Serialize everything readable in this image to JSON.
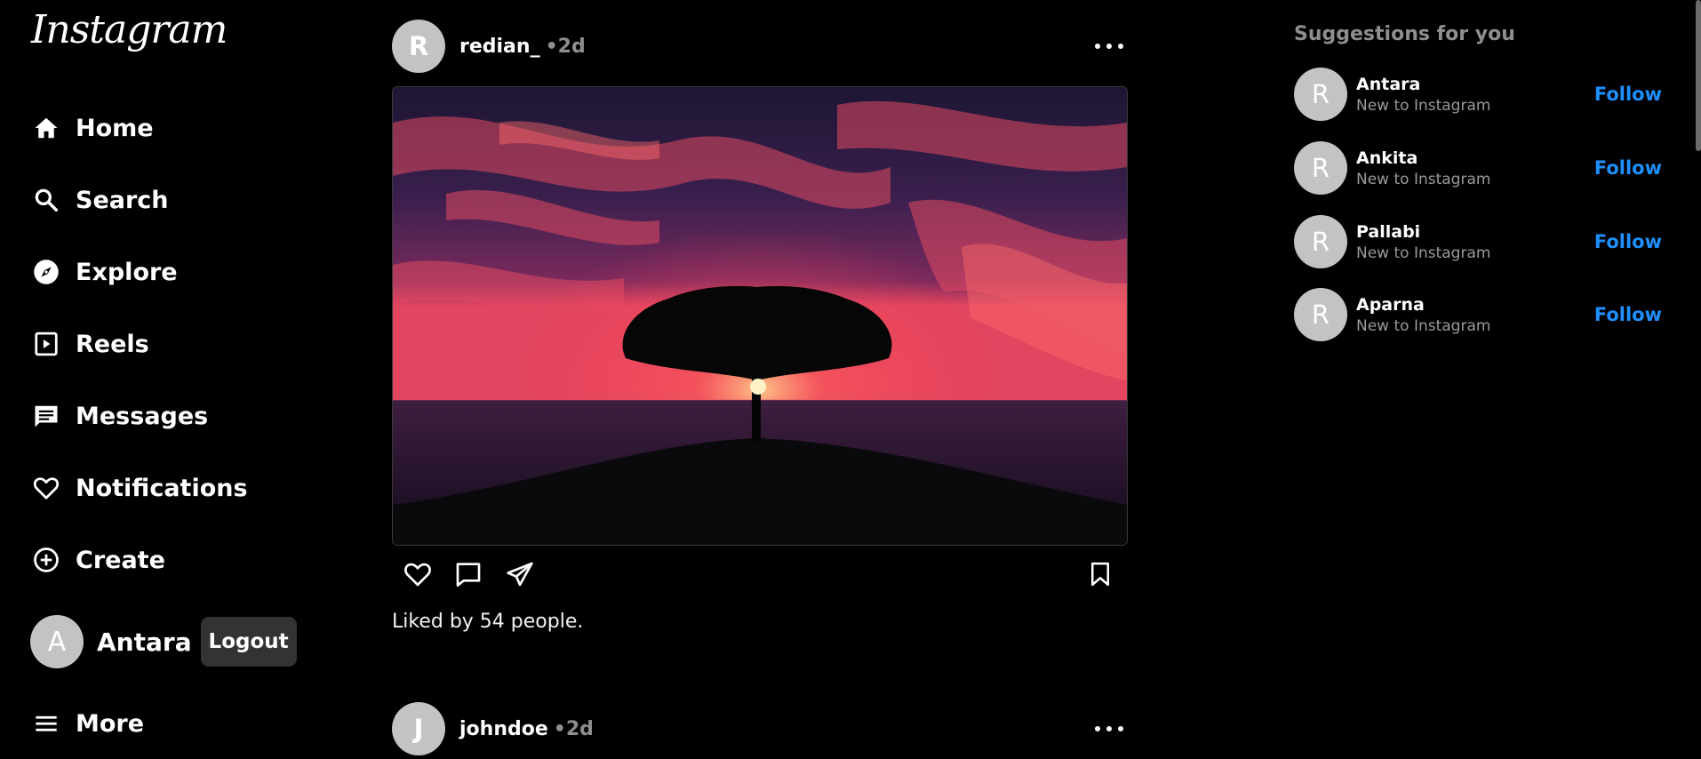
{
  "app": {
    "logo_text": "Instagram"
  },
  "sidebar": {
    "items": [
      {
        "label": "Home",
        "icon": "home-icon"
      },
      {
        "label": "Search",
        "icon": "search-icon"
      },
      {
        "label": "Explore",
        "icon": "compass-icon"
      },
      {
        "label": "Reels",
        "icon": "reels-icon"
      },
      {
        "label": "Messages",
        "icon": "message-icon"
      },
      {
        "label": "Notifications",
        "icon": "heart-icon"
      },
      {
        "label": "Create",
        "icon": "plus-circle-icon"
      }
    ],
    "user": {
      "avatar_letter": "A",
      "name": "Antara",
      "logout_label": "Logout"
    },
    "more_label": "More"
  },
  "feed": {
    "posts": [
      {
        "avatar_letter": "R",
        "username": "redian_",
        "time": "•2d",
        "likes_text": "Liked by 54 people."
      },
      {
        "avatar_letter": "J",
        "username": "johndoe",
        "time": "•2d"
      }
    ]
  },
  "suggestions": {
    "title": "Suggestions for you",
    "items": [
      {
        "avatar_letter": "R",
        "name": "Antara",
        "subtitle": "New to Instagram",
        "action": "Follow"
      },
      {
        "avatar_letter": "R",
        "name": "Ankita",
        "subtitle": "New to Instagram",
        "action": "Follow"
      },
      {
        "avatar_letter": "R",
        "name": "Pallabi",
        "subtitle": "New to Instagram",
        "action": "Follow"
      },
      {
        "avatar_letter": "R",
        "name": "Aparna",
        "subtitle": "New to Instagram",
        "action": "Follow"
      }
    ]
  },
  "colors": {
    "background": "#000000",
    "link": "#1e90ff",
    "muted": "#8e8e8e",
    "avatar": "#c3c3c3"
  }
}
